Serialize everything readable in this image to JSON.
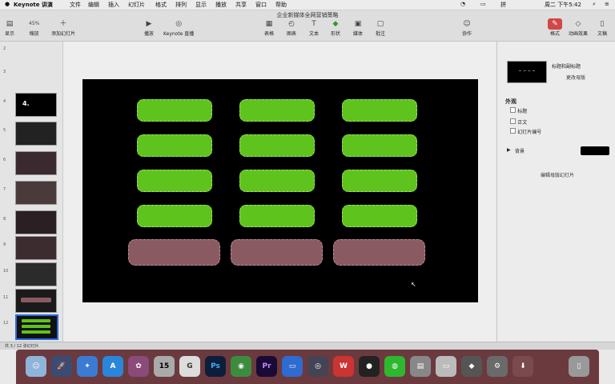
{
  "menubar": {
    "apple": "",
    "app_name": "Keynote 讲演",
    "menus": [
      "文件",
      "编辑",
      "插入",
      "幻灯片",
      "格式",
      "排列",
      "显示",
      "播放",
      "共享",
      "窗口",
      "帮助"
    ],
    "clock": "周二 下午5:42"
  },
  "document_title": "企业新媒体全网营销策略",
  "toolbar": {
    "view_label": "显示",
    "zoom_value": "45%",
    "zoom_label": "缩放",
    "add_slide_label": "添加幻灯片",
    "play_label": "播放",
    "keynote_live_label": "Keynote 直播",
    "table_label": "表格",
    "chart_label": "图表",
    "text_label": "文本",
    "shape_label": "形状",
    "media_label": "媒体",
    "comment_label": "批注",
    "collaborate_label": "协作",
    "format_label": "格式",
    "animate_label": "动画效果",
    "document_label": "文稿"
  },
  "navigator": {
    "slides": [
      {
        "num": "2"
      },
      {
        "num": "3"
      },
      {
        "num": "4",
        "text": "4."
      },
      {
        "num": "5"
      },
      {
        "num": "6"
      },
      {
        "num": "7"
      },
      {
        "num": "8"
      },
      {
        "num": "9"
      },
      {
        "num": "10"
      },
      {
        "num": "11"
      },
      {
        "num": "12"
      }
    ]
  },
  "inspector": {
    "change_master_label": "更改母版",
    "master_name": "标题和副标题",
    "appearance_heading": "外观",
    "appearance_options": [
      "标题",
      "正文",
      "幻灯片编号"
    ],
    "background_label": "背景",
    "edit_master_label": "编辑母版幻灯片",
    "background_color": "#000000"
  },
  "statusbar": {
    "text": "共 3 / 12 张幻灯片"
  },
  "colors": {
    "green_button": "#5ec31c",
    "mauve_button": "#8a5a62",
    "accent": "#d24747"
  },
  "dock": {
    "icons": [
      "finder-icon",
      "launchpad-icon",
      "safari-icon",
      "appstore-icon",
      "mail-icon",
      "calendar-icon",
      "photos-icon",
      "photoshop-icon",
      "chrome-icon",
      "premiere-icon",
      "keynote-icon",
      "quicktime-icon",
      "wps-icon",
      "qq-icon",
      "wechat-icon",
      "notes-icon",
      "preview-icon",
      "sourcetree-icon",
      "systemprefs-icon",
      "downloads-icon",
      "trash-icon"
    ],
    "calendar_day": "15",
    "ps_label": "Ps",
    "pr_label": "Pr"
  }
}
